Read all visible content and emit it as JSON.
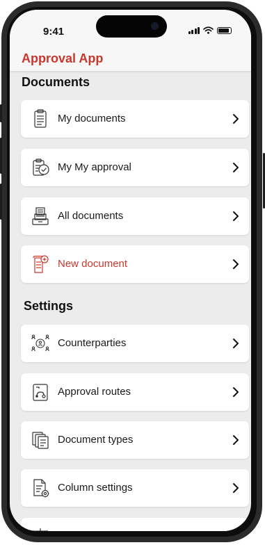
{
  "status_bar": {
    "time": "9:41"
  },
  "header": {
    "title": "Approval App"
  },
  "sections": [
    {
      "title": "Documents",
      "items": [
        {
          "label": "My documents",
          "icon": "document-icon"
        },
        {
          "label": "My My approval",
          "icon": "approval-icon"
        },
        {
          "label": "All documents",
          "icon": "document-stack-icon"
        },
        {
          "label": "New document",
          "icon": "new-document-icon",
          "accent": true
        }
      ]
    },
    {
      "title": "Settings",
      "items": [
        {
          "label": "Counterparties",
          "icon": "counterparties-icon"
        },
        {
          "label": "Approval routes",
          "icon": "route-icon"
        },
        {
          "label": "Document types",
          "icon": "document-types-icon"
        },
        {
          "label": "Column settings",
          "icon": "column-settings-icon"
        }
      ]
    }
  ],
  "colors": {
    "accent": "#c8372d",
    "background": "#ececec",
    "card": "#ffffff"
  }
}
